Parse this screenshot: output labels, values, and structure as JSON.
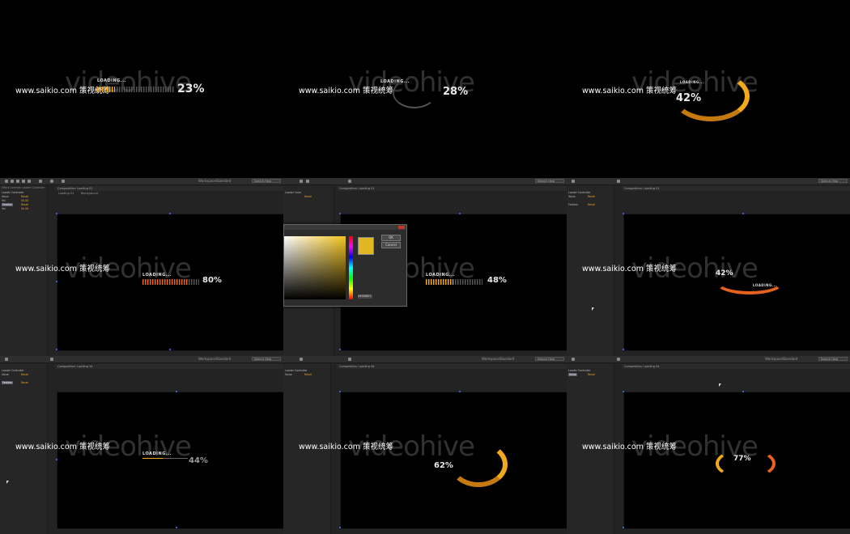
{
  "watermark": {
    "site": "www.saikio.com 策视统筹",
    "logo": "videohive"
  },
  "loader_labels": {
    "loading": "LOADING...",
    "loading_small": "LOADING..."
  },
  "cells": [
    {
      "pct": "23%",
      "progress": 0.23
    },
    {
      "pct": "28%",
      "progress": 0.28
    },
    {
      "pct": "42%",
      "progress": 0.42
    },
    {
      "pct": "80%",
      "progress": 0.8
    },
    {
      "pct": "48%",
      "progress": 0.48
    },
    {
      "pct": "42%",
      "progress": 0.42
    },
    {
      "pct": "44%",
      "progress": 0.44
    },
    {
      "pct": "62%",
      "progress": 0.62
    },
    {
      "pct": "77%",
      "progress": 0.77
    }
  ],
  "ae": {
    "workspace_label": "Workspace:",
    "workspace_value": "Standard",
    "search_placeholder": "Search Help",
    "composition_tab": "Composition: Loading 01",
    "composition_tab_2": "Composition: Loading 04",
    "composition_tab_3": "Composition: Loading 06",
    "effect_controls_tab": "Effect Controls: Loader Controller",
    "sub_tab_1": "Loading 01",
    "sub_tab_2": "Background",
    "fx_header": "Loader Controller",
    "fx_rows": [
      {
        "label": "Value",
        "value": "Reset"
      },
      {
        "label": "Val",
        "value": "00.00"
      },
      {
        "label": "Feather",
        "value": "Reset"
      },
      {
        "label": "Val",
        "value": "00.00"
      }
    ],
    "fx_color_header": "Loader Color"
  },
  "picker": {
    "ok": "OK",
    "cancel": "Cancel",
    "hex": "#E0B623"
  },
  "colors": {
    "accent": "#f2a91c",
    "ae_panel": "#232323",
    "ae_selection": "#3b62c8",
    "value_orange": "#e8a33a"
  }
}
